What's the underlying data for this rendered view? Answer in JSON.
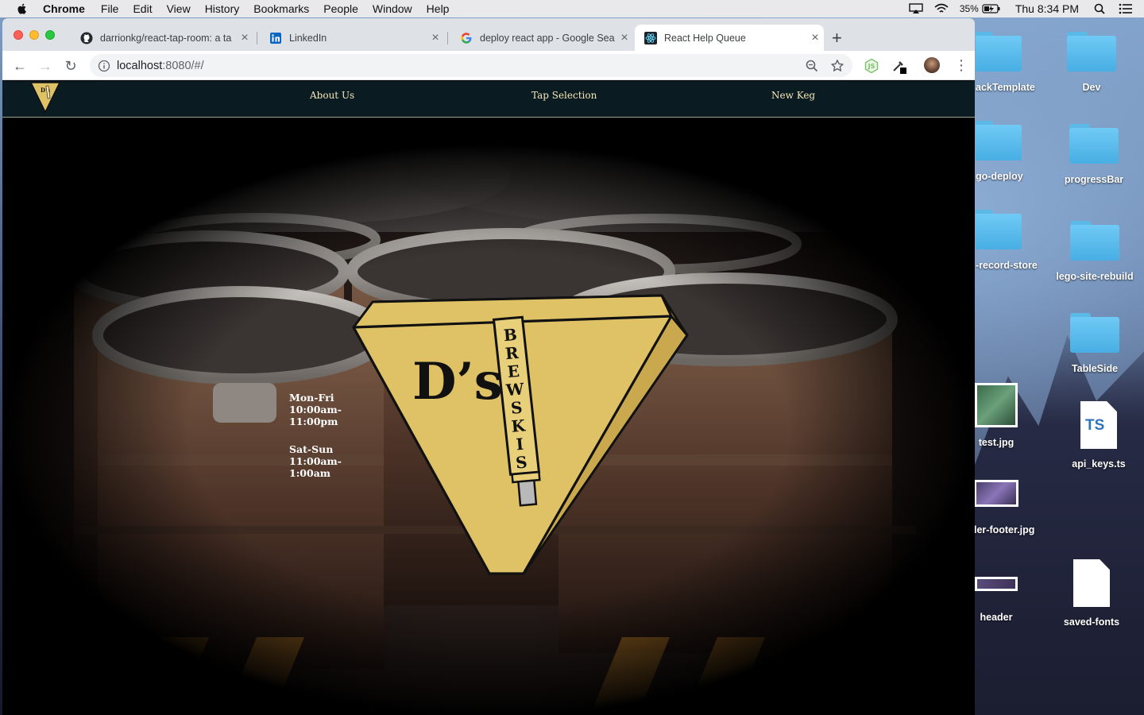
{
  "menubar": {
    "app_name": "Chrome",
    "items": [
      "File",
      "Edit",
      "View",
      "History",
      "Bookmarks",
      "People",
      "Window",
      "Help"
    ],
    "battery": "35%",
    "clock": "Thu 8:34 PM"
  },
  "browser": {
    "tabs": [
      {
        "title": "darrionkg/react-tap-room: a ta",
        "icon": "github-icon"
      },
      {
        "title": "LinkedIn",
        "icon": "linkedin-icon"
      },
      {
        "title": "deploy react app - Google Sea",
        "icon": "google-icon"
      },
      {
        "title": "React Help Queue",
        "icon": "react-icon",
        "active": true
      }
    ],
    "url_host": "localhost",
    "url_rest": ":8080/#/"
  },
  "site": {
    "nav": [
      "About Us",
      "Tap Selection",
      "New Keg"
    ],
    "hours": {
      "weekday_days": "Mon-Fri",
      "weekday_open": "10:00am-",
      "weekday_close": "11:00pm",
      "weekend_days": "Sat-Sun",
      "weekend_open": "11:00am-",
      "weekend_close": "1:00am"
    },
    "logo": {
      "main": "D’s",
      "tap_letters": [
        "B",
        "R",
        "E",
        "W",
        "S",
        "K",
        "I",
        "S"
      ],
      "brand_color": "#e0c266"
    }
  },
  "desktop": {
    "items": [
      {
        "label": "ackTemplate",
        "kind": "folder"
      },
      {
        "label": "Dev",
        "kind": "folder"
      },
      {
        "label": "go-deploy",
        "kind": "folder"
      },
      {
        "label": "progressBar",
        "kind": "folder"
      },
      {
        "label": "-record-store",
        "kind": "folder"
      },
      {
        "label": "lego-site-rebuild",
        "kind": "folder"
      },
      {
        "label": "TableSide",
        "kind": "folder"
      },
      {
        "label": "test.jpg",
        "kind": "image"
      },
      {
        "label": "api_keys.ts",
        "kind": "ts-file"
      },
      {
        "label": "ler-footer.jpg",
        "kind": "image"
      },
      {
        "label": "header",
        "kind": "image"
      },
      {
        "label": "saved-fonts",
        "kind": "file"
      }
    ]
  }
}
